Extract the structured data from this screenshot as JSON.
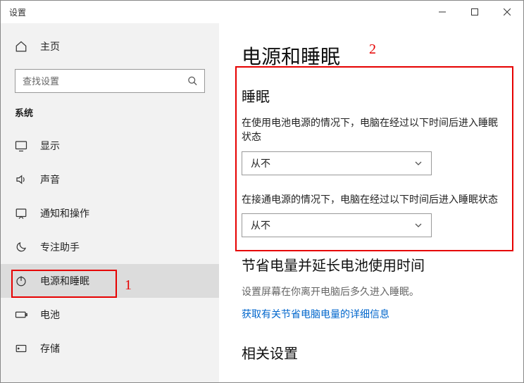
{
  "window": {
    "title": "设置"
  },
  "sidebar": {
    "home": "主页",
    "search_placeholder": "查找设置",
    "group": "系统",
    "items": [
      {
        "label": "显示"
      },
      {
        "label": "声音"
      },
      {
        "label": "通知和操作"
      },
      {
        "label": "专注助手"
      },
      {
        "label": "电源和睡眠"
      },
      {
        "label": "电池"
      },
      {
        "label": "存储"
      }
    ]
  },
  "annotations": {
    "a1": "1",
    "a2": "2"
  },
  "main": {
    "title": "电源和睡眠",
    "sleep_section": {
      "heading": "睡眠",
      "battery_label": "在使用电池电源的情况下，电脑在经过以下时间后进入睡眠状态",
      "battery_value": "从不",
      "plugged_label": "在接通电源的情况下，电脑在经过以下时间后进入睡眠状态",
      "plugged_value": "从不"
    },
    "save_section": {
      "heading": "节省电量并延长电池使用时间",
      "desc": "设置屏幕在你离开电脑后多久进入睡眠。",
      "link": "获取有关节省电脑电量的详细信息"
    },
    "related_section": {
      "heading": "相关设置"
    }
  }
}
